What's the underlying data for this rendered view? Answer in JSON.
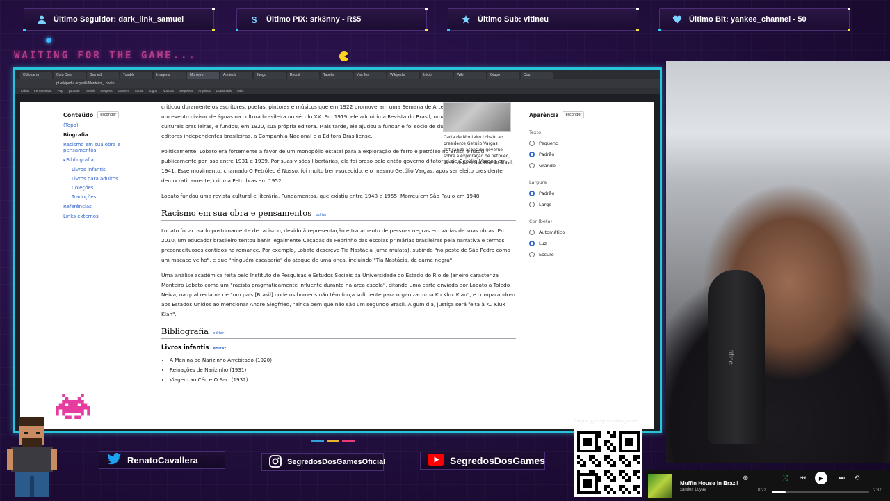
{
  "alerts": [
    {
      "label": "Último Seguidor: dark_link_samuel",
      "icon": "user-icon"
    },
    {
      "label": "Último PIX: srk3nny - R$5",
      "icon": "dollar-icon"
    },
    {
      "label": "Último Sub: vitineu",
      "icon": "star-icon"
    },
    {
      "label": "Último Bit: yankee_channel - 50",
      "icon": "heart-icon"
    }
  ],
  "waiting_text": "WAITING FOR THE GAME...",
  "browser": {
    "url": "pt.wikipedia.org/wiki/Monteiro_Lobato",
    "tabs": [
      "Odio de m",
      "Com Dem",
      "Gamer2",
      "Tumblr",
      "Imagens",
      "Monteiro",
      "Ars tech",
      "Juego",
      "Reddit",
      "Tabela",
      "Yan Jos",
      "Wikipedia",
      "Inicio",
      "Wiki",
      "Grupo",
      "Odu"
    ],
    "bookmarks": [
      "Todos",
      "Ferramentas",
      "Pop",
      "youtube",
      "Tumblr",
      "Imagens",
      "Gamers",
      "Social",
      "Jogos",
      "Noticias",
      "Segredos",
      "Arquivos",
      "Downloads",
      "Mais"
    ]
  },
  "toc": {
    "title": "Conteúdo",
    "hide_label": "esconder",
    "items": [
      {
        "label": "(Topo)",
        "kind": "link"
      },
      {
        "label": "Biografia",
        "kind": "current"
      },
      {
        "label": "Racismo em sua obra e pensamentos",
        "kind": "link"
      },
      {
        "label": "Bibliografia",
        "kind": "link"
      },
      {
        "label": "Livros infantis",
        "kind": "sub"
      },
      {
        "label": "Livros para adultos",
        "kind": "sub"
      },
      {
        "label": "Coleções",
        "kind": "sub"
      },
      {
        "label": "Traduções",
        "kind": "sub"
      },
      {
        "label": "Referências",
        "kind": "link"
      },
      {
        "label": "Links externos",
        "kind": "link"
      }
    ]
  },
  "article": {
    "p1": "criticou duramente os escritores, poetas, pintores e músicos que em 1922 promoveram uma Semana de Arte Moderna, que tornou-se um evento divisor de águas na cultura brasileira no século XX. Em 1919, ele adquiriu a Revista do Brasil, uma das primeiras revistas culturais brasileiras, e fundou, em 1920, sua própria editora. Mais tarde, ele ajudou a fundar e foi sócio de duas das mais importantes editoras independentes brasileiras, a Companhia Nacional e a Editora Brasiliense.",
    "p2": "Politicamente, Lobato era fortemente a favor de um monopólio estatal para a exploração de ferro e petróleo no Brasil e lutou publicamente por isso entre 1931 e 1939. Por suas visões libertárias, ele foi preso pelo então governo ditatorial de Getúlio Vargas em 1941. Esse movimento, chamado O Petróleo é Nosso, foi muito bem-sucedido, e o mesmo Getúlio Vargas, após ser eleito presidente democraticamente, criou a Petrobras em 1952.",
    "p3": "Lobato fundou uma revista cultural e literária, Fundamentos, que existiu entre 1948 e 1955. Morreu em São Paulo em 1948.",
    "h2_racismo": "Racismo em sua obra e pensamentos",
    "edit": "editar",
    "p4": "Lobato foi acusado postumamente de racismo, devido à representação e tratamento de pessoas negras em várias de suas obras. Em 2010, um educador brasileiro tentou banir legalmente Caçadas de Pedrinho das escolas primárias brasileiras pela narrativa e termos preconceituosos contidos no romance. Por exemplo, Lobato descreve Tia Nastácia (uma mulata), subindo \"no poste de São Pedro como um macaco velho\", e que \"ninguém escaparia\" do ataque de uma onça, incluindo \"Tia Nastácia, de carne negra\".",
    "p5": "Uma análise acadêmica feita pelo Instituto de Pesquisas e Estudos Sociais da Universidade do Estado do Rio de Janeiro caracteriza Monteiro Lobato como um \"racista pragmaticamente influente durante na área escola\", citando uma carta enviada por Lobato a Toledo Neiva, na qual reclama de \"um país [Brasil] onde os homens não têm força suficiente para organizar uma Ku Klux Klan\", e comparando-o aos Estados Unidos ao mencionar André Siegfried, \"ainca bem que não são um segundo Brasil. Algum dia, justiça será feita à Ku Klux Klan\".",
    "h2_bibliografia": "Bibliografia",
    "h3_livros": "Livros infantis",
    "books": [
      "A Menina do Narizinho Arrebitado (1920)",
      "Reinações de Narizinho (1931)",
      "Viagem ao Céu e O Saci (1932)"
    ],
    "caption": "Carta de Monteiro Lobato ao presidente Getúlio Vargas criticando ações do governo sobre a exploração de petróleo, 1940. Arquivo Nacional do Brasil."
  },
  "appearance": {
    "title": "Aparência",
    "hide_label": "esconder",
    "texto": "Texto",
    "text_options": [
      {
        "label": "Pequeno",
        "on": false
      },
      {
        "label": "Padrão",
        "on": true
      },
      {
        "label": "Grande",
        "on": false
      }
    ],
    "largura": "Largura",
    "width_options": [
      {
        "label": "Padrão",
        "on": true
      },
      {
        "label": "Largo",
        "on": false
      }
    ],
    "cor": "Cor (beta)",
    "color_options": [
      {
        "label": "Automático",
        "on": false
      },
      {
        "label": "Luz",
        "on": true
      },
      {
        "label": "Escuro",
        "on": false
      }
    ]
  },
  "socials": [
    {
      "label": "RenatoCavallera",
      "icon": "twitter-icon"
    },
    {
      "label": "SegredosDosGamesOficial",
      "icon": "instagram-icon"
    },
    {
      "label": "SegredosDosGames",
      "icon": "youtube-icon"
    }
  ],
  "qr": {
    "label": "livepix.gg/segredosdosgames"
  },
  "player": {
    "title": "Muffin House In Brazil",
    "artist": "xander, Loyae",
    "elapsed": "0:22",
    "duration": "2:37",
    "progress": 0.14
  },
  "webcam": {
    "mic_brand": "fifine"
  },
  "colors": {
    "frame": "#27c3d9",
    "accent_pink": "#e63ca0",
    "accent_yellow": "#f5e43a"
  }
}
